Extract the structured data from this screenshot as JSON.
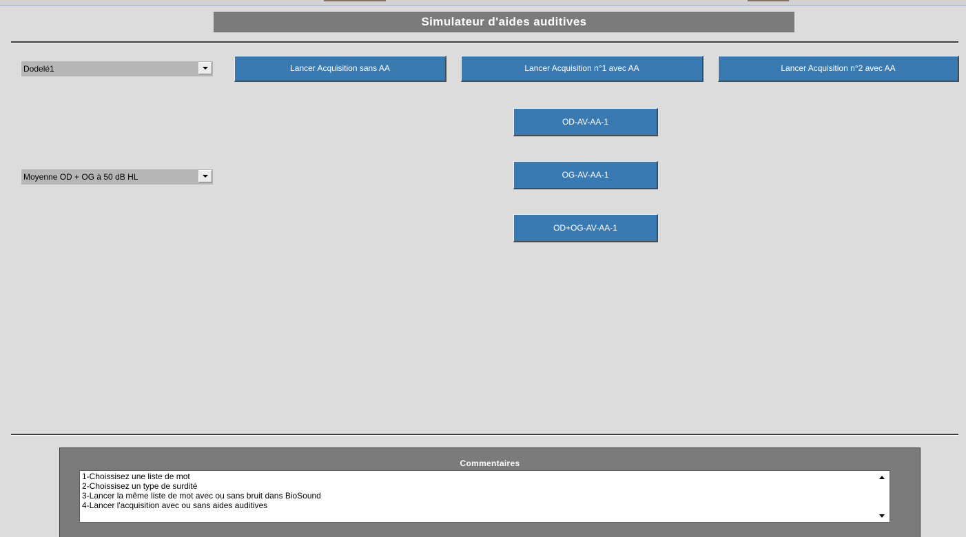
{
  "app": {
    "title": "Simulateur d'aides auditives"
  },
  "selectors": {
    "word_list": "Dodelé1",
    "hearing_loss": "Moyenne OD + OG à 50 dB HL"
  },
  "acquisition_buttons": [
    "Lancer Acquisition sans AA",
    "Lancer Acquisition n°1 avec AA",
    "Lancer Acquisition n°2 avec AA"
  ],
  "result_buttons": [
    "OD-AV-AA-1",
    "OG-AV-AA-1",
    "OD+OG-AV-AA-1"
  ],
  "comments": {
    "title": "Commentaires",
    "lines": [
      "1-Choissisez une liste de mot",
      "2-Choissisez un type de surdité",
      "3-Lancer la même liste de mot avec ou sans bruit dans BioSound",
      "4-Lancer l'acquisition avec ou sans aides auditives"
    ]
  },
  "colors": {
    "background": "#dcdcdc",
    "button": "#3a7ab3",
    "title_bar": "#7b7b7b",
    "select": "#b6b6b6"
  },
  "icons": {
    "dropdown": "chevron-down-icon",
    "scroll_up": "scroll-up-icon",
    "scroll_down": "scroll-down-icon"
  }
}
